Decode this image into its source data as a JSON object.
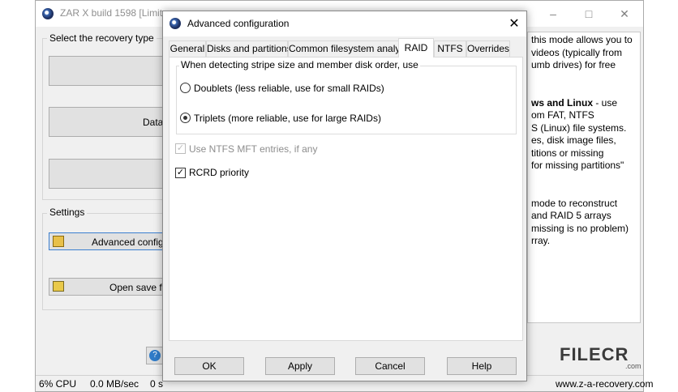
{
  "main_window": {
    "title": "ZAR X build 1598 [Limite",
    "recovery_group_label": "Select the recovery type",
    "recovery_buttons": [
      "",
      "Data",
      ""
    ],
    "settings_group_label": "Settings",
    "advanced_btn": "Advanced configu",
    "open_save_btn": "Open save fil",
    "help_lines": [
      "this mode allows you to",
      "videos (typically from",
      "umb drives) for free",
      "",
      "",
      "ws and Linux - use",
      "om FAT, NTFS",
      "S (Linux) file systems.",
      "es, disk image files,",
      "titions or missing",
      "for missing partitions\"",
      "",
      "",
      "mode to reconstruct",
      "and RAID 5 arrays",
      "missing is no problem)",
      "rray."
    ],
    "status": {
      "cpu": "6% CPU",
      "speed": "0.0 MB/sec",
      "time": "0 s",
      "site": "www.z-a-recovery.com"
    }
  },
  "dialog": {
    "title": "Advanced configuration",
    "tabs": [
      "General",
      "Disks and partitions",
      "Common filesystem analysis",
      "RAID",
      "NTFS",
      "Overrides"
    ],
    "group_label": "When detecting stripe size and member disk order, use",
    "option_doublets": "Doublets (less reliable, use for small RAIDs)",
    "option_triplets": "Triplets (more reliable, use for large RAIDs)",
    "check_ntfs_mft": "Use NTFS MFT entries, if any",
    "check_rcrd": "RCRD priority",
    "buttons": {
      "ok": "OK",
      "apply": "Apply",
      "cancel": "Cancel",
      "help": "Help"
    }
  },
  "watermark": {
    "text": "FILECR",
    "suffix": ".com"
  }
}
